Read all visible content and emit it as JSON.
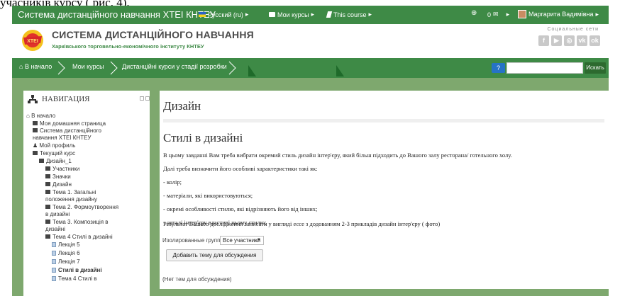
{
  "document": {
    "caption": "учасників курсу ( рис. 4)."
  },
  "topbar": {
    "site_title": "Система дистанційного навчання ХТЕІ КНТЕУ",
    "language": "Русский (ru)",
    "my_courses": "Мои курсы",
    "this_course": "This course",
    "messages": "0",
    "user_name": "Маргарита Вадимівна"
  },
  "header": {
    "brand_title": "СИСТЕМА ДИСТАНЦІЙНОГО НАВЧАННЯ",
    "brand_subtitle": "Харківського торговельно-економічного інституту КНТЕУ",
    "logo_text": "ХТЕІ",
    "social_title": "Социальные сети",
    "social_icons": [
      "facebook-icon",
      "youtube-icon",
      "instagram-icon",
      "vk-icon",
      "odnoklassniki-icon"
    ]
  },
  "navbar": {
    "breadcrumbs": [
      "В начало",
      "Мои курсы",
      "Дистанційні курси у стадії розробки"
    ],
    "help": "?",
    "search_placeholder": "",
    "search_button": "Искать"
  },
  "navigation": {
    "title": "НАВИГАЦИЯ",
    "items": [
      "В начало",
      "Моя домашняя страница",
      "Система дистанційного",
      "навчання ХТЕІ КНТЕУ",
      "Мой профиль",
      "Текущий курс",
      "Дизайн_1",
      "Участники",
      "Значки",
      "Дизайн",
      "Тема 1. Загальні",
      "положення дизайну",
      "Тема 2. Формоутворення",
      "в дизайні",
      "Тема 3. Композиція в",
      "дизайні",
      "Тема 4 Стилі в дизайні",
      "Лекція 5",
      "Лекція 6",
      "Лекція 7",
      "Стилі в дизайні",
      "Тема 4 Стилі в"
    ]
  },
  "main": {
    "title": "Дизайн",
    "section_title": "Стилі в дизайні",
    "paragraphs": [
      "В цьому завданні Вам треба вибрати окремий стиль дизайн інтер'єру, який більш підходить до Вашого залу ресторана/ готельного холу.",
      "Далі треба визначити його особливі характеристики такі як:",
      "- колір;",
      "- матеріали, які використовуються;",
      "- окремі особливості стилю, які відрізняють його від інших;",
      "- деталі інтер'єру властиві цьому стилю;",
      "Результат Вашого дослідження записати у вигляді ессе з додованням 2-3 прикладів дизайн інтер'єру ( фото)"
    ],
    "group_label": "Изолированные группы",
    "group_select": "Все участники",
    "add_button": "Добавить тему для обсуждения",
    "empty_text": "(Нет тем для обсуждения)"
  },
  "colors": {
    "primary_green": "#3e8a46",
    "page_background": "#7ea86e",
    "help_blue": "#2673c6"
  }
}
